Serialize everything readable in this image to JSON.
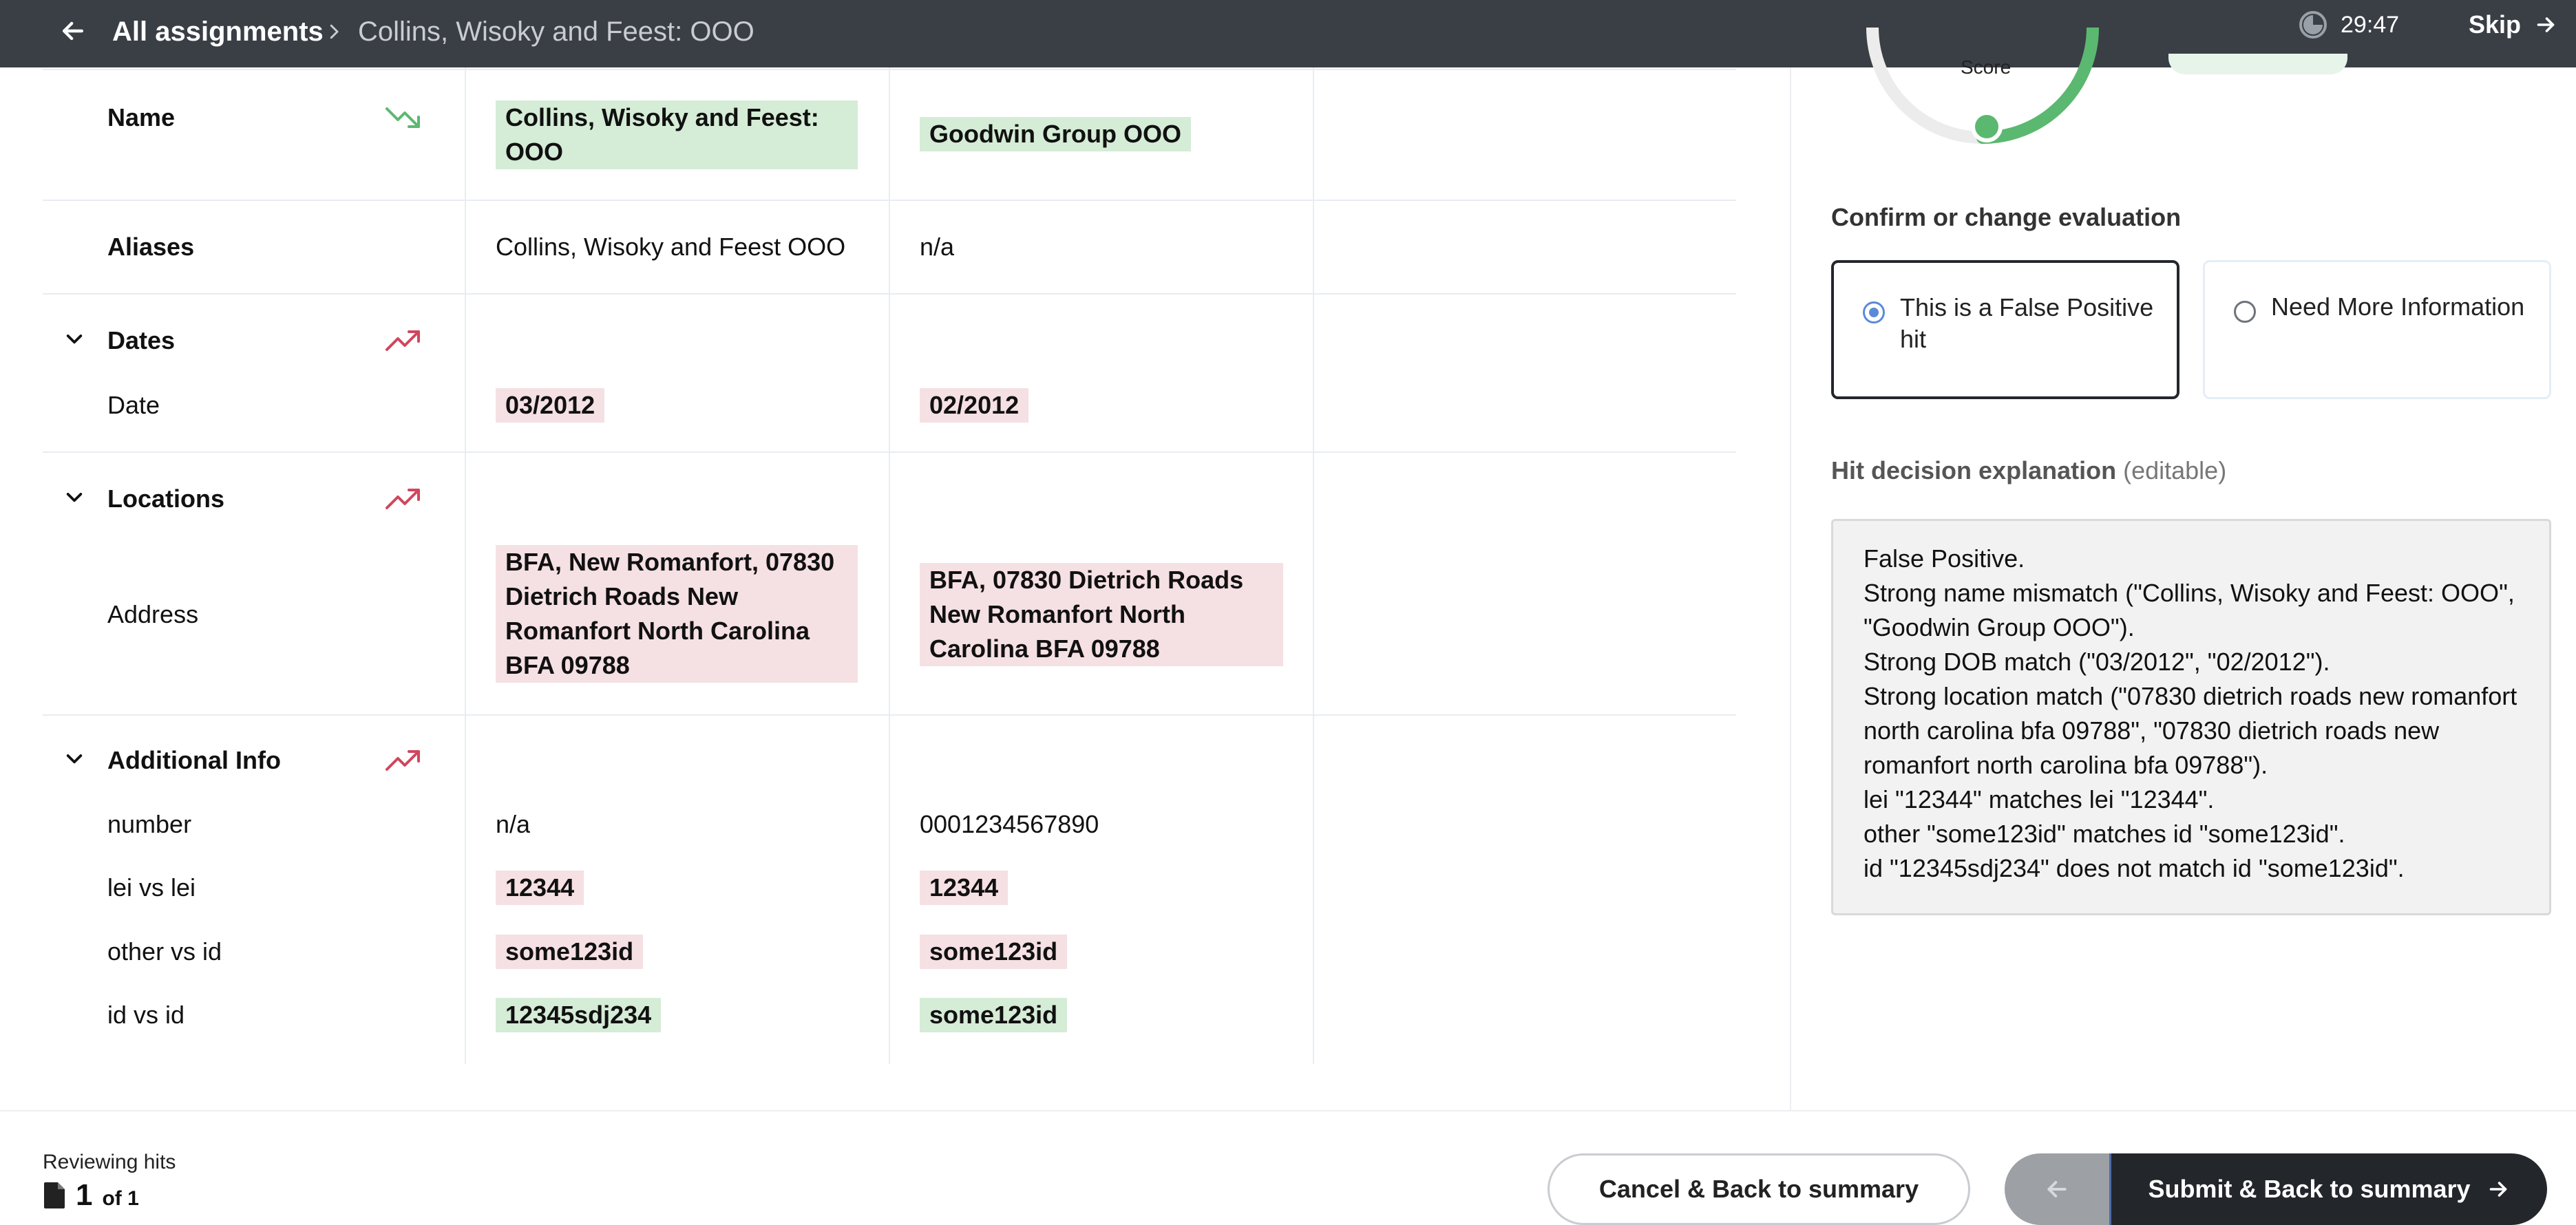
{
  "topbar": {
    "breadcrumb_root": "All assignments",
    "breadcrumb_current": "Collins, Wisoky and Feest: OOO",
    "timer": "29:47",
    "skip_label": "Skip"
  },
  "comparison": {
    "name": {
      "label": "Name",
      "trend": "down",
      "left": "Collins, Wisoky and Feest: OOO",
      "right": "Goodwin Group OOO",
      "status": "match"
    },
    "aliases": {
      "label": "Aliases",
      "left": "Collins, Wisoky and Feest OOO",
      "right": "n/a"
    },
    "dates": {
      "section_label": "Dates",
      "trend": "up",
      "row_label": "Date",
      "left": "03/2012",
      "right": "02/2012",
      "status": "mismatch"
    },
    "locations": {
      "section_label": "Locations",
      "trend": "up",
      "row_label": "Address",
      "left": "BFA, New Romanfort, 07830 Dietrich Roads New Romanfort North Carolina BFA 09788",
      "right": "BFA, 07830 Dietrich Roads New Romanfort North Carolina BFA 09788",
      "status": "mismatch"
    },
    "additional_info": {
      "section_label": "Additional Info",
      "trend": "up",
      "rows": [
        {
          "label": "number",
          "left": "n/a",
          "right": "0001234567890",
          "status": "none"
        },
        {
          "label": "lei vs lei",
          "left": "12344",
          "right": "12344",
          "status": "mismatch"
        },
        {
          "label": "other vs id",
          "left": "some123id",
          "right": "some123id",
          "status": "mismatch"
        },
        {
          "label": "id vs id",
          "left": "12345sdj234",
          "right": "some123id",
          "status": "match"
        }
      ]
    }
  },
  "panel": {
    "score_label": "Score",
    "confirm_title": "Confirm or change evaluation",
    "options": [
      {
        "label": "This is a False Positive hit",
        "selected": true
      },
      {
        "label": "Need More Information",
        "selected": false
      }
    ],
    "explanation_title": "Hit decision explanation",
    "explanation_suffix": "(editable)",
    "explanation_text": "False Positive.\nStrong name mismatch (\"Collins, Wisoky and Feest: OOO\", \"Goodwin Group OOO\").\nStrong DOB match (\"03/2012\", \"02/2012\").\nStrong location match (\"07830 dietrich roads new romanfort north carolina bfa 09788\", \"07830 dietrich roads new romanfort north carolina bfa 09788\").\nlei \"12344\" matches lei \"12344\".\nother \"some123id\" matches id \"some123id\".\nid \"12345sdj234\" does not match id \"some123id\"."
  },
  "footer": {
    "reviewing_label": "Reviewing hits",
    "page_current": "1",
    "page_of": "of 1",
    "cancel_label": "Cancel & Back to summary",
    "submit_label": "Submit & Back to summary"
  },
  "colors": {
    "topbar_bg": "#3a3f46",
    "match_bg": "#d5ecd6",
    "mismatch_bg": "#f5e0e3",
    "trend_up": "#d0465e",
    "trend_down": "#5bb870",
    "accent_radio": "#5b8ad8",
    "submit_bg": "#23262b"
  },
  "icons": {
    "back": "arrow-left-icon",
    "breadcrumb_separator": "chevron-right-icon",
    "timer": "timer-icon",
    "skip": "arrow-right-icon",
    "section_toggle": "chevron-down-icon",
    "trend_up": "trending-up-icon",
    "trend_down": "trending-down-icon",
    "page": "document-icon"
  }
}
